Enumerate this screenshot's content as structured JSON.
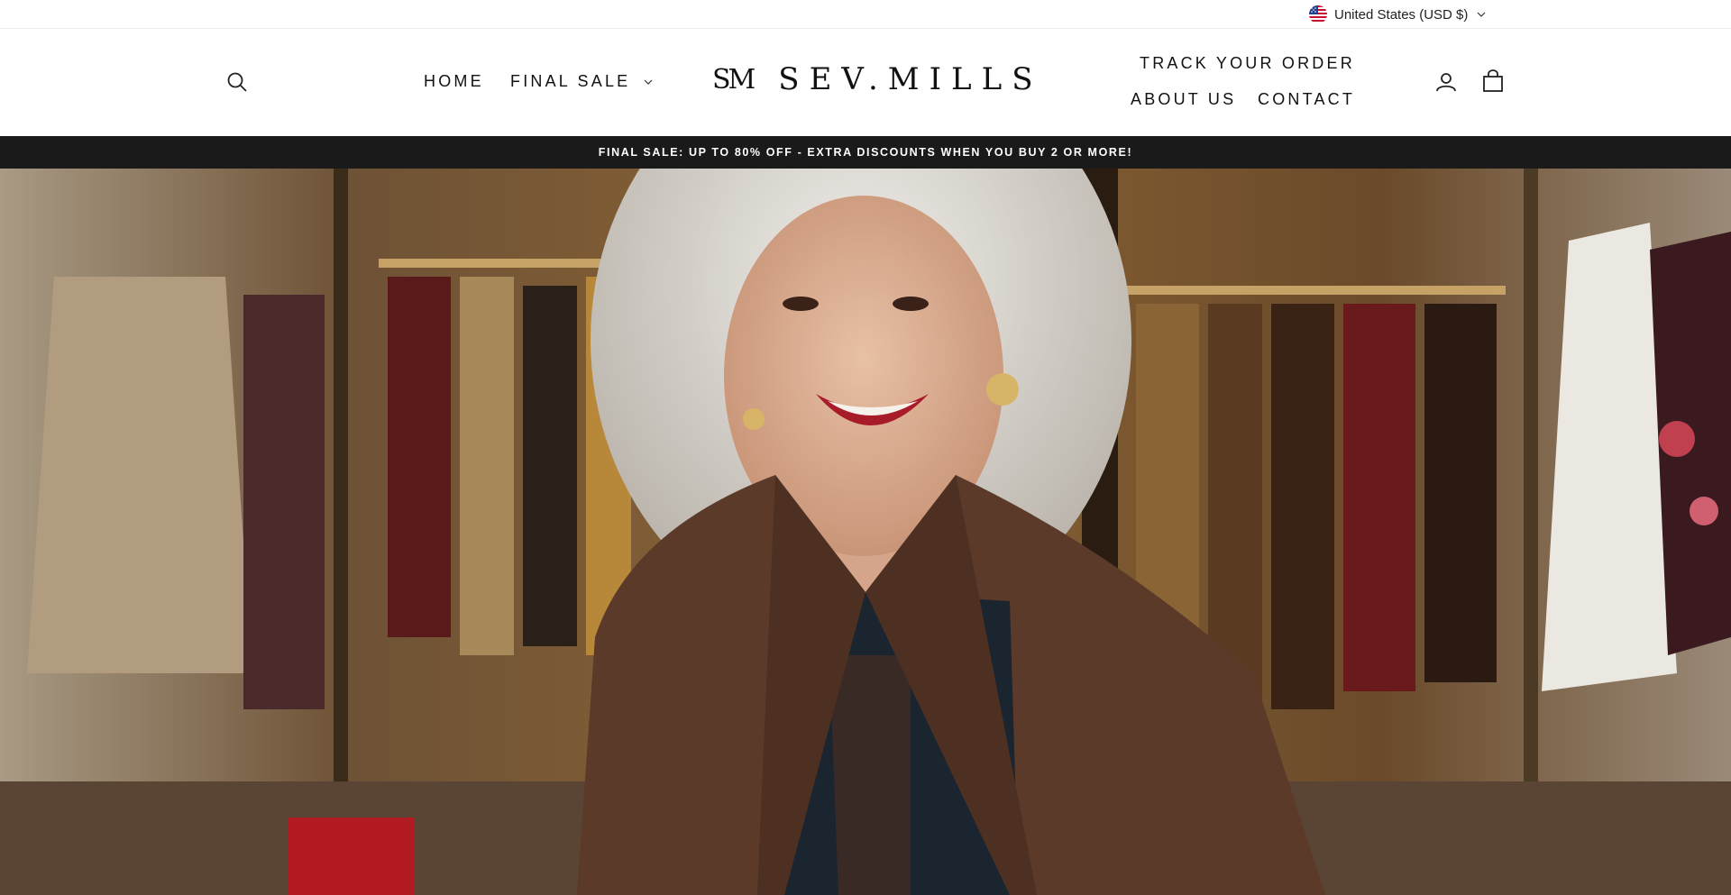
{
  "utility": {
    "currency_label": "United States (USD $)",
    "flag_icon": "us-flag-icon"
  },
  "header": {
    "logo_mark": "SM",
    "logo_text": "SEV.MILLS",
    "nav": {
      "home": "HOME",
      "final_sale": "FINAL SALE",
      "track_order": "TRACK YOUR ORDER",
      "about_us": "ABOUT US",
      "contact": "CONTACT"
    },
    "icons": [
      "search-icon",
      "account-icon",
      "cart-icon",
      "chevron-down-icon"
    ]
  },
  "announcement": {
    "text": "FINAL SALE: UP TO 80% OFF - EXTRA DISCOUNTS WHEN YOU BUY 2 OR MORE!"
  },
  "colors": {
    "announcement_bg": "#1a1a1a",
    "text": "#111111",
    "background": "#ffffff"
  }
}
